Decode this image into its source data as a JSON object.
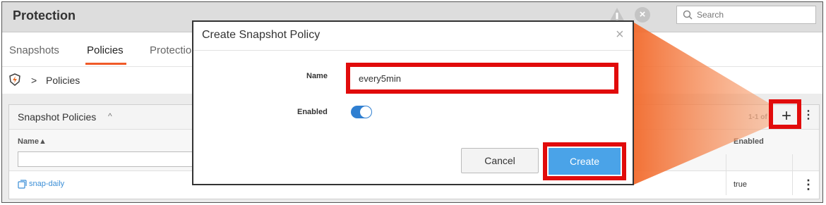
{
  "header": {
    "title": "Protection",
    "search_placeholder": "Search"
  },
  "tabs": [
    {
      "label": "Snapshots"
    },
    {
      "label": "Policies"
    },
    {
      "label": "Protectio"
    }
  ],
  "breadcrumb": {
    "separator": ">",
    "current": "Policies"
  },
  "panel": {
    "title": "Snapshot Policies",
    "pager": "1-1 of 1",
    "columns": {
      "name": "Name▲",
      "enabled": "Enabled"
    },
    "rows": [
      {
        "name": "snap-daily",
        "enabled": "true"
      }
    ]
  },
  "modal": {
    "title": "Create Snapshot Policy",
    "name_label": "Name",
    "name_value": "every5min",
    "enabled_label": "Enabled",
    "enabled": true,
    "cancel_label": "Cancel",
    "create_label": "Create"
  },
  "colors": {
    "accent": "#f05a28",
    "highlight": "#e10b0b",
    "primary": "#4aa3e8",
    "toggle": "#2f7fd1"
  },
  "icons": [
    "warning-icon",
    "close-circle-icon",
    "search-icon",
    "protection-icon",
    "plus-icon",
    "kebab-icon",
    "snapshot-icon",
    "close-icon"
  ]
}
